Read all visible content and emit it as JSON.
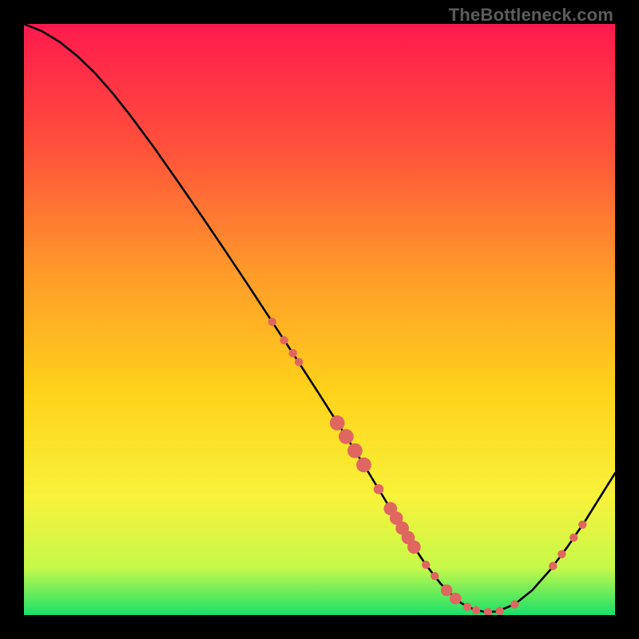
{
  "watermark": "TheBottleneck.com",
  "colors": {
    "dot": "#e06660",
    "curve": "#000000",
    "background_black": "#000000"
  },
  "chart_data": {
    "type": "line",
    "title": "",
    "xlabel": "",
    "ylabel": "",
    "xlim": [
      0,
      100
    ],
    "ylim": [
      0,
      100
    ],
    "gradient_stops": [
      {
        "offset": 0,
        "color": "#ff1a4e"
      },
      {
        "offset": 0.2,
        "color": "#ff4e3c"
      },
      {
        "offset": 0.42,
        "color": "#ff9a2a"
      },
      {
        "offset": 0.62,
        "color": "#ffd21a"
      },
      {
        "offset": 0.8,
        "color": "#f8f23a"
      },
      {
        "offset": 0.92,
        "color": "#c6f94a"
      },
      {
        "offset": 1.0,
        "color": "#18e06a"
      }
    ],
    "series": [
      {
        "name": "bottleneck-curve",
        "x": [
          0.0,
          3.0,
          6.0,
          9.0,
          12.0,
          15.0,
          18.0,
          22.0,
          26.0,
          30.0,
          34.0,
          38.0,
          42.0,
          46.0,
          50.0,
          54.0,
          58.0,
          60.0,
          62.0,
          64.0,
          66.0,
          68.0,
          70.5,
          72.5,
          74.0,
          76.0,
          78.0,
          80.0,
          83.0,
          86.0,
          89.0,
          92.0,
          95.0,
          98.0,
          100.0
        ],
        "y": [
          100.0,
          98.8,
          97.0,
          94.6,
          91.7,
          88.3,
          84.5,
          79.1,
          73.4,
          67.6,
          61.7,
          55.7,
          49.6,
          43.5,
          37.3,
          31.0,
          24.6,
          21.3,
          18.0,
          14.7,
          11.5,
          8.5,
          5.3,
          3.3,
          2.0,
          1.0,
          0.5,
          0.6,
          1.8,
          4.2,
          7.6,
          11.6,
          16.0,
          20.8,
          24.0
        ]
      }
    ],
    "dots": [
      {
        "x": 42.0,
        "y": 49.6,
        "r": 1.0
      },
      {
        "x": 44.0,
        "y": 46.5,
        "r": 1.0
      },
      {
        "x": 45.5,
        "y": 44.3,
        "r": 1.0
      },
      {
        "x": 46.5,
        "y": 42.8,
        "r": 1.0
      },
      {
        "x": 53.0,
        "y": 32.5,
        "r": 1.8
      },
      {
        "x": 54.5,
        "y": 30.2,
        "r": 1.8
      },
      {
        "x": 56.0,
        "y": 27.8,
        "r": 1.8
      },
      {
        "x": 57.5,
        "y": 25.4,
        "r": 1.8
      },
      {
        "x": 60.0,
        "y": 21.3,
        "r": 1.2
      },
      {
        "x": 62.0,
        "y": 18.0,
        "r": 1.6
      },
      {
        "x": 63.0,
        "y": 16.4,
        "r": 1.6
      },
      {
        "x": 64.0,
        "y": 14.7,
        "r": 1.6
      },
      {
        "x": 65.0,
        "y": 13.1,
        "r": 1.6
      },
      {
        "x": 66.0,
        "y": 11.5,
        "r": 1.6
      },
      {
        "x": 68.0,
        "y": 8.5,
        "r": 1.0
      },
      {
        "x": 69.5,
        "y": 6.6,
        "r": 1.0
      },
      {
        "x": 71.5,
        "y": 4.2,
        "r": 1.4
      },
      {
        "x": 73.0,
        "y": 2.8,
        "r": 1.4
      },
      {
        "x": 75.0,
        "y": 1.4,
        "r": 1.0
      },
      {
        "x": 76.5,
        "y": 0.8,
        "r": 1.0
      },
      {
        "x": 78.5,
        "y": 0.5,
        "r": 1.0
      },
      {
        "x": 80.5,
        "y": 0.7,
        "r": 1.0
      },
      {
        "x": 83.0,
        "y": 1.8,
        "r": 1.0
      },
      {
        "x": 89.5,
        "y": 8.3,
        "r": 1.0
      },
      {
        "x": 91.0,
        "y": 10.3,
        "r": 1.0
      },
      {
        "x": 93.0,
        "y": 13.1,
        "r": 1.0
      },
      {
        "x": 94.5,
        "y": 15.3,
        "r": 1.0
      }
    ]
  }
}
